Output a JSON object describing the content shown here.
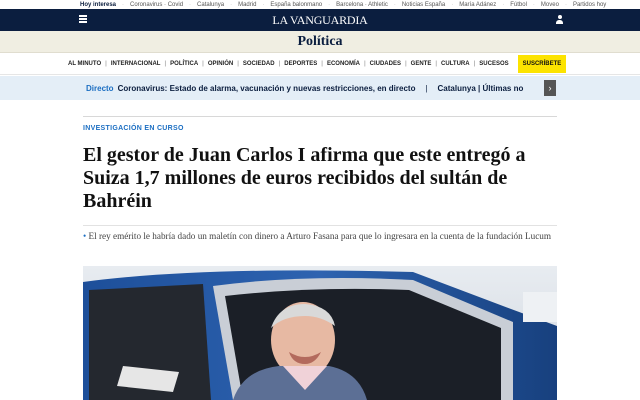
{
  "topbar": {
    "label": "Hoy interesa",
    "links": [
      "Coronavirus · Covid",
      "Catalunya",
      "Madrid",
      "España balonmano",
      "Barcelona · Athletic",
      "Noticias España",
      "María Adánez",
      "Fútbol",
      "Moveo",
      "Partidos hoy"
    ]
  },
  "masthead": {
    "logo": "LA VANGUARDIA"
  },
  "section": {
    "title": "Política"
  },
  "nav": {
    "items": [
      "AL MINUTO",
      "INTERNACIONAL",
      "POLÍTICA",
      "OPINIÓN",
      "SOCIEDAD",
      "DEPORTES",
      "ECONOMÍA",
      "CIUDADES",
      "GENTE",
      "CULTURA",
      "SUCESOS"
    ],
    "subscribe": "SUSCRÍBETE"
  },
  "directo": {
    "label": "Directo",
    "text": "Coronavirus: Estado de alarma, vacunación y nuevas restricciones, en directo",
    "text2": "Catalunya | Últimas no"
  },
  "article": {
    "kicker": "INVESTIGACIÓN EN CURSO",
    "headline": "El gestor de Juan Carlos I afirma que este entregó a Suiza 1,7 millones de euros recibidos del sultán de Bahréin",
    "summary": "El rey emérito le habría dado un maletín con dinero a Arturo Fasana para que lo ingresara en la cuenta de la fundación Lucum"
  },
  "colors": {
    "navy": "#0b1e3f",
    "accent_blue": "#1b6ec2",
    "subscribe_yellow": "#fce300",
    "section_bg": "#f0eee2",
    "directo_bg": "#e4eef7"
  }
}
